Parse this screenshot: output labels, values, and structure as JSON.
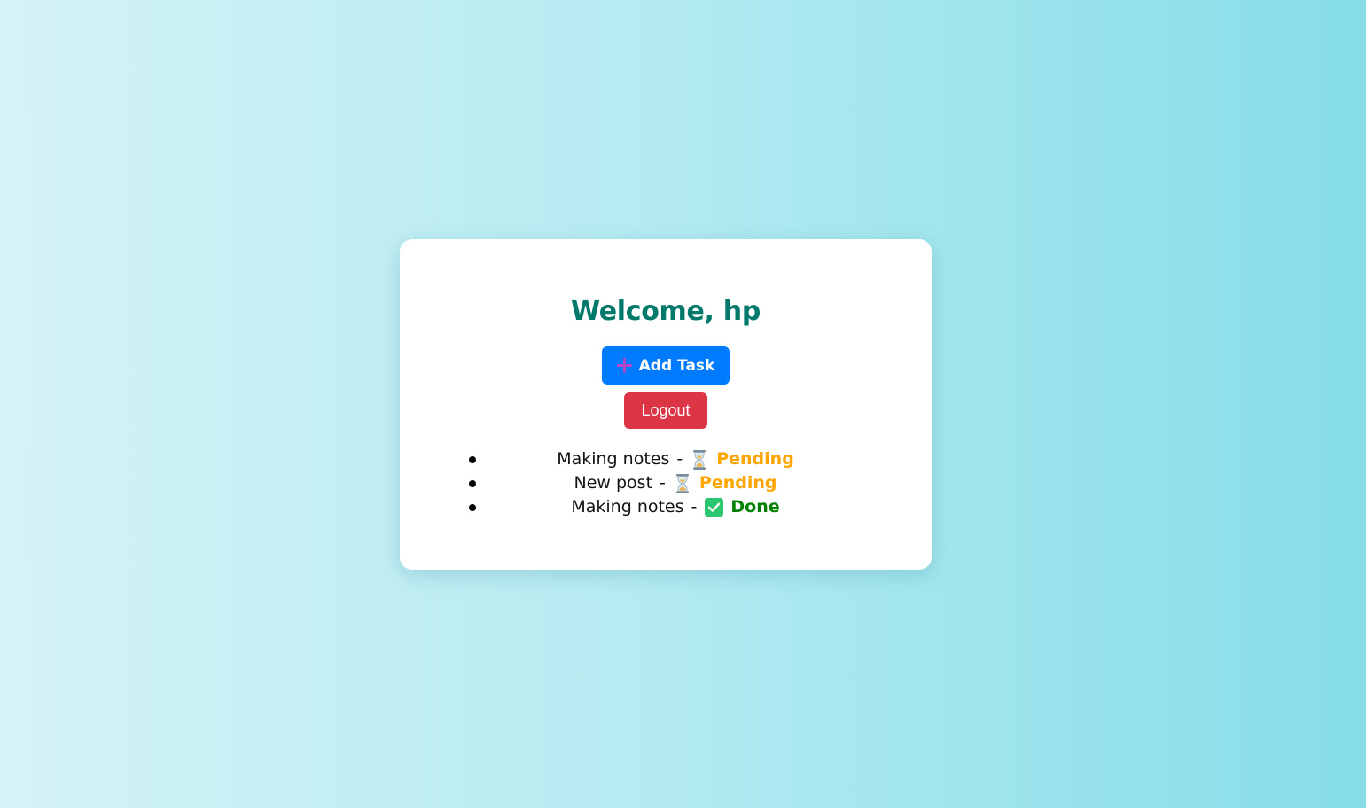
{
  "header": {
    "title": "Welcome, hp"
  },
  "actions": {
    "add_task_label": "Add Task",
    "add_task_icon": "plus-icon",
    "logout_label": "Logout"
  },
  "tasks": [
    {
      "title": "Making notes",
      "separator": "-",
      "status": "Pending",
      "status_icon": "hourglass-icon"
    },
    {
      "title": "New post",
      "separator": "-",
      "status": "Pending",
      "status_icon": "hourglass-icon"
    },
    {
      "title": "Making notes",
      "separator": "-",
      "status": "Done",
      "status_icon": "check-icon"
    }
  ],
  "colors": {
    "title": "#00796b",
    "add_button": "#007bff",
    "logout_button": "#dc3545",
    "pending": "#ffa500",
    "done": "#008000",
    "plus_icon": "#b048c8",
    "check_box": "#28c76f"
  }
}
